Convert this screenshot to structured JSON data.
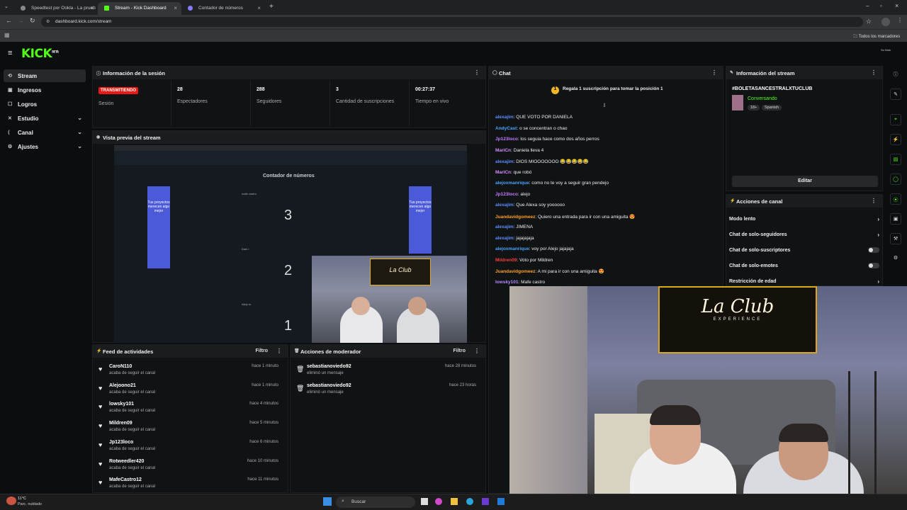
{
  "browser": {
    "tabs": [
      {
        "label": "Speedtest por Ookla - La prueb",
        "active": false
      },
      {
        "label": "Stream - Kick Dashboard",
        "active": true
      },
      {
        "label": "Contador de números",
        "active": false
      }
    ],
    "url": "dashboard.kick.com/stream",
    "bookmarks_label": "Todos los marcadores"
  },
  "kick": {
    "logo": "KICK",
    "logo_sup": "BETA",
    "user": "Su Niuk"
  },
  "sidebar": {
    "items": [
      {
        "label": "Stream",
        "icon": "stream-icon",
        "active": true
      },
      {
        "label": "Ingresos",
        "icon": "money-icon"
      },
      {
        "label": "Logros",
        "icon": "trophy-icon"
      },
      {
        "label": "Estudio",
        "icon": "studio-icon",
        "chevron": true
      },
      {
        "label": "Canal",
        "icon": "channel-icon",
        "chevron": true
      },
      {
        "label": "Ajustes",
        "icon": "gear-icon",
        "chevron": true
      }
    ]
  },
  "session": {
    "title": "Información de la sesión",
    "live_badge": "TRANSMITIENDO",
    "session_label": "Sesión",
    "stats": [
      {
        "value": "28",
        "label": "Espectadores"
      },
      {
        "value": "288",
        "label": "Seguidores"
      },
      {
        "value": "3",
        "label": "Cantidad de suscripciones"
      },
      {
        "value": "00:27:37",
        "label": "Tiempo en vivo"
      }
    ]
  },
  "preview": {
    "title": "Vista previa del stream",
    "counter_title": "Contador de números",
    "card_text": "Tus proyectos merecen algo mejor",
    "numbers": [
      "3",
      "2",
      "1"
    ],
    "names": [
      "mafe castro",
      "Dani r",
      "Alejo m"
    ],
    "neon": "La Club"
  },
  "feed": {
    "title": "Feed de actividades",
    "filter": "Filtro",
    "subtitle": "acaba de seguir el canal",
    "rows": [
      {
        "user": "CaroN110",
        "time": "hace 1 minuto"
      },
      {
        "user": "Alejoono21",
        "time": "hace 1 minuto"
      },
      {
        "user": "lowsky101",
        "time": "hace 4 minutos"
      },
      {
        "user": "Mildren09",
        "time": "hace 5 minutos"
      },
      {
        "user": "Jp123loco",
        "time": "hace 6 minutos"
      },
      {
        "user": "Rotweedler420",
        "time": "hace 10 minutos"
      },
      {
        "user": "MafeCastro12",
        "time": "hace 11 minutos"
      }
    ]
  },
  "modactions": {
    "title": "Acciones de moderador",
    "filter": "Filtro",
    "subtitle": "eliminó un mensaje",
    "rows": [
      {
        "user": "sebastianoviedo92",
        "time": "hace 28 minutos"
      },
      {
        "user": "sebastianoviedo92",
        "time": "hace 23 horas"
      }
    ]
  },
  "chat": {
    "title": "Chat",
    "pinned": "Regala 1 suscripción para tomar la posición 1",
    "messages": [
      {
        "user": "alexajim",
        "text": ": QUE VOTO POR DANIELA",
        "color": "#5b8cff"
      },
      {
        "user": "AndyCast",
        "text": ": o se concentran o chao",
        "color": "#4aa3ff"
      },
      {
        "user": "Jp123loco",
        "text": ": los seguia hace como dos años perros",
        "color": "#c678ff"
      },
      {
        "user": "MariCn",
        "text": ": Daniela lleva 4",
        "color": "#d88bff"
      },
      {
        "user": "alexajim",
        "text": ": DIOS MIOOOOOOO 😂😂😂😂😂",
        "color": "#5b8cff"
      },
      {
        "user": "MariCn",
        "text": ": que robó",
        "color": "#d88bff"
      },
      {
        "user": "alejoxmanrique",
        "text": ": como no te voy a seguir gran pendejo",
        "color": "#4aa3ff"
      },
      {
        "user": "Jp123loco",
        "text": ": alejo",
        "color": "#c678ff"
      },
      {
        "user": "alexajim",
        "text": ": Que Alexa soy yoooooo",
        "color": "#5b8cff"
      },
      {
        "user": "Juandavidgomeez",
        "text": ": Quiero una entrada para ir con una amiguita 😍",
        "color": "#ff9e2c"
      },
      {
        "user": "alexajim",
        "text": ": JIMENA",
        "color": "#5b8cff"
      },
      {
        "user": "alexajim",
        "text": ": jajajajaja",
        "color": "#5b8cff"
      },
      {
        "user": "alejoxmanrique",
        "text": ": voy por Alejo jajajaja",
        "color": "#4aa3ff"
      },
      {
        "user": "Mildren09",
        "text": ": Voto por Mildren",
        "color": "#ff3b3b"
      },
      {
        "user": "Juandavidgomeez",
        "text": ": A mi para ir con una amiguita 😍",
        "color": "#ff9e2c"
      },
      {
        "user": "lowsky101",
        "text": ": Mafe castro",
        "color": "#b68bff"
      }
    ]
  },
  "streaminfo": {
    "title": "Información del stream",
    "stream_title": "#BOLETASANCESTRALXTUCLUB",
    "category": "Conversando",
    "tags": [
      "18+",
      "Spanish"
    ],
    "edit": "Editar"
  },
  "channelactions": {
    "title": "Acciones de canal",
    "items": [
      {
        "label": "Modo lento",
        "kind": "arrow"
      },
      {
        "label": "Chat de solo-seguidores",
        "kind": "arrow"
      },
      {
        "label": "Chat de solo-suscriptores",
        "kind": "toggle"
      },
      {
        "label": "Chat de solo-emotes",
        "kind": "toggle"
      },
      {
        "label": "Restricción de edad",
        "kind": "arrow"
      }
    ]
  },
  "webcam": {
    "neon": "La Club",
    "neon_sub": "EXPERIENCE"
  },
  "taskbar": {
    "temp": "11°C",
    "weather": "Parc. nublado",
    "search": "Buscar"
  },
  "colors": {
    "kick_green": "#53fc18",
    "live_red": "#e91916",
    "panel": "#101314"
  }
}
